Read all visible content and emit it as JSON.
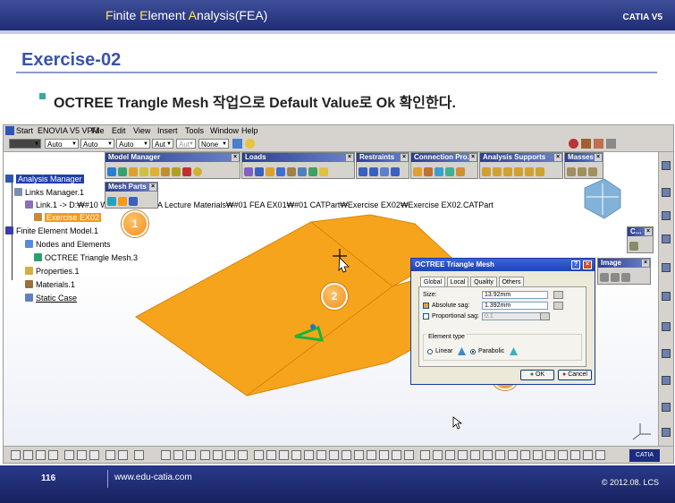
{
  "slide": {
    "header_title_parts": [
      "F",
      "inite ",
      "E",
      "lement ",
      "A",
      "nalysis(FEA)"
    ],
    "brand": "CATIA V5",
    "exercise_title": "Exercise-02",
    "instruction": "OCTREE Trangle Mesh 작업으로 Default Value로 Ok 확인한다.",
    "page_number": "116",
    "url": "www.edu-catia.com",
    "copyright": "© 2012.08. LCS"
  },
  "app": {
    "menu": [
      "Start",
      "ENOVIA V5 VPM",
      "File",
      "Edit",
      "View",
      "Insert",
      "Tools",
      "Window",
      "Help"
    ],
    "combos": [
      "Auto",
      "Auto",
      "Auto",
      "Aut",
      "Aut",
      "None"
    ],
    "toolbars": {
      "model_manager": "Model Manager",
      "mesh_parts": "Mesh Parts",
      "loads": "Loads",
      "restraints": "Restraints",
      "connection_properties": "Connection Pro...",
      "analysis_supports": "Analysis Supports",
      "masses": "Masses",
      "image": "Image",
      "small": "C..."
    },
    "tree": {
      "root": "Analysis Manager",
      "links_manager": "Links Manager.1",
      "link": "Link.1 -> D:₩#10 W",
      "part": "Exercise EX02",
      "fem": "Finite Element Model.1",
      "nodes": "Nodes and Elements",
      "mesh": "OCTREE Triangle Mesh.3",
      "properties": "Properties.1",
      "materials": "Materials.1",
      "static_case": "Static Case"
    },
    "path_text": "A Lecture Materials₩#01 FEA EX01₩#01 CATPart₩Exercise EX02₩Exercise EX02.CATPart",
    "accent_orange": "#f7a41d",
    "selection_blue": "#1f3fa8"
  },
  "steps": [
    "1",
    "2",
    "3"
  ],
  "dialog": {
    "title": "OCTREE Triangle Mesh",
    "tabs": [
      "Global",
      "Local",
      "Quality",
      "Others"
    ],
    "size_label": "Size:",
    "size_value": "13.92mm",
    "absolute_sag_label": "Absolute sag:",
    "absolute_sag_value": "1.392mm",
    "absolute_sag_checked": true,
    "proportional_sag_label": "Proportional sag:",
    "proportional_sag_value": "0.1",
    "proportional_sag_checked": false,
    "element_type_label": "Element type",
    "linear_label": "Linear",
    "parabolic_label": "Parabolic",
    "selected_element_type": "Parabolic",
    "ok_label": "OK",
    "cancel_label": "Cancel",
    "help_icon": "?",
    "close_icon": "×"
  }
}
